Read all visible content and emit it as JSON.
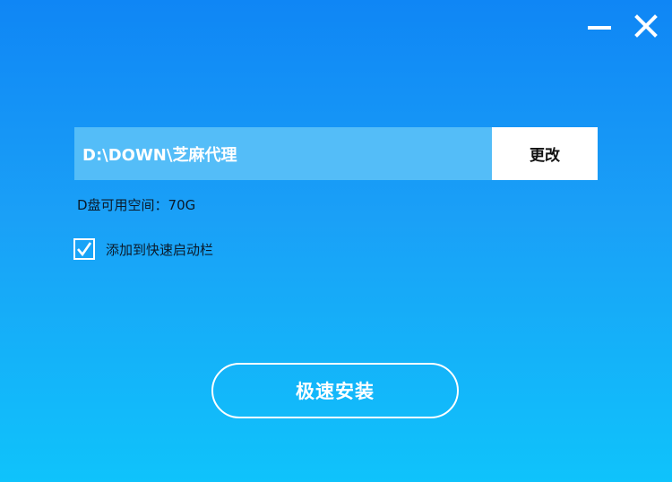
{
  "window": {
    "minimize_icon": "minimize-icon",
    "close_icon": "close-icon",
    "background_top": "#0f86f5",
    "background_bottom": "#0fc3fb"
  },
  "install_path": {
    "value": "D:\\DOWN\\芝麻代理",
    "change_label": "更改"
  },
  "disk_space": {
    "text": "D盘可用空间：70G"
  },
  "quick_launch": {
    "checked": true,
    "label": "添加到快速启动栏"
  },
  "install_button": {
    "label": "极速安装"
  }
}
